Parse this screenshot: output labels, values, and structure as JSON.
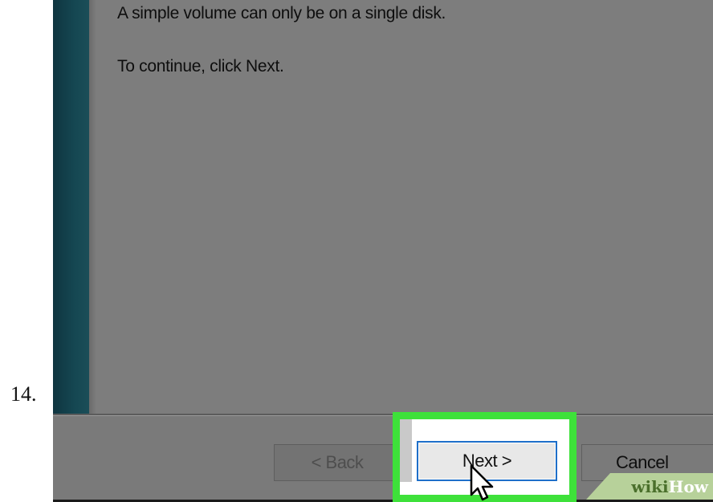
{
  "step": {
    "number": "14."
  },
  "dialog": {
    "line1": "A simple volume can only be on a single disk.",
    "line2": "To continue, click Next."
  },
  "buttons": {
    "back_label": "< Back",
    "next_label": "Next >",
    "cancel_label": "Cancel"
  },
  "watermark": {
    "part1": "wiki",
    "part2": "How"
  },
  "colors": {
    "highlight": "#3ee13a",
    "next_border": "#1e6fc9",
    "sidebar": "#154752",
    "dialog_bg": "#7d7d7d"
  },
  "icons": {
    "cursor": "mouse-pointer-icon"
  }
}
